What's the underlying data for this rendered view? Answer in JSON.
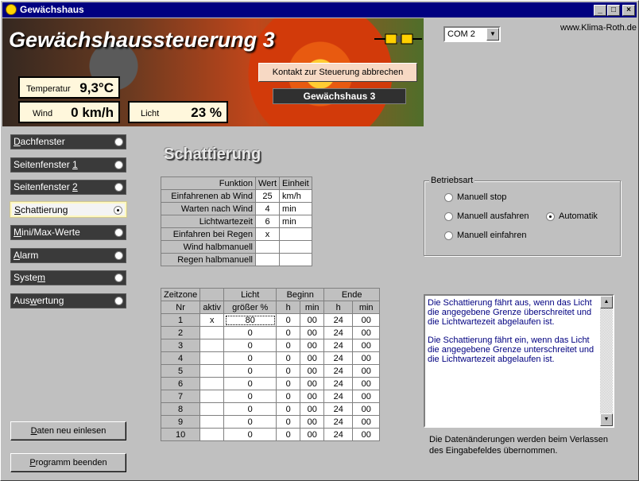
{
  "window": {
    "title": "Gewächshaus",
    "buttons": [
      "_",
      "□",
      "×"
    ]
  },
  "header": {
    "title": "Gewächshaussteuerung 3",
    "url": "www.Klima-Roth.de",
    "com_port": "COM 2",
    "temperature": {
      "label": "Temperatur",
      "value": "9,3°C"
    },
    "wind": {
      "label": "Wind",
      "value": "0 km/h"
    },
    "light": {
      "label": "Licht",
      "value": "23 %"
    },
    "abort_button": "Kontakt zur Steuerung abbrechen",
    "greenhouse_name": "Gewächshaus 3"
  },
  "nav": {
    "items": [
      {
        "pre": "",
        "ak": "D",
        "post": "achfenster",
        "active": false
      },
      {
        "pre": "Seitenfenster ",
        "ak": "1",
        "post": "",
        "active": false
      },
      {
        "pre": "Seitenfenster ",
        "ak": "2",
        "post": "",
        "active": false
      },
      {
        "pre": "",
        "ak": "S",
        "post": "chattierung",
        "active": true
      },
      {
        "pre": "",
        "ak": "M",
        "post": "ini/Max-Werte",
        "active": false
      },
      {
        "pre": "",
        "ak": "A",
        "post": "larm",
        "active": false
      },
      {
        "pre": "Syste",
        "ak": "m",
        "post": "",
        "active": false
      },
      {
        "pre": "Aus",
        "ak": "w",
        "post": "ertung",
        "active": false
      }
    ]
  },
  "buttons": {
    "reload": {
      "pre": "",
      "ak": "D",
      "post": "aten neu einlesen"
    },
    "quit": {
      "pre": "",
      "ak": "P",
      "post": "rogramm beenden"
    }
  },
  "section": {
    "title": "Schattierung"
  },
  "params_table": {
    "headers": [
      "Funktion",
      "Wert",
      "Einheit"
    ],
    "rows": [
      [
        "Einfahrenen ab Wind",
        "25",
        "km/h"
      ],
      [
        "Warten nach Wind",
        "4",
        "min"
      ],
      [
        "Lichtwartezeit",
        "6",
        "min"
      ],
      [
        "Einfahren bei Regen",
        "x",
        ""
      ],
      [
        "Wind halbmanuell",
        "",
        ""
      ],
      [
        "Regen halbmanuell",
        "",
        ""
      ]
    ]
  },
  "zones_table": {
    "header_top": [
      "Zeitzone",
      "",
      "Licht",
      "Beginn",
      "Ende"
    ],
    "header_sub": [
      "Nr",
      "aktiv",
      "größer %",
      "h",
      "min",
      "h",
      "min"
    ],
    "rows": [
      [
        "1",
        "x",
        "80",
        "0",
        "00",
        "24",
        "00"
      ],
      [
        "2",
        "",
        "0",
        "0",
        "00",
        "24",
        "00"
      ],
      [
        "3",
        "",
        "0",
        "0",
        "00",
        "24",
        "00"
      ],
      [
        "4",
        "",
        "0",
        "0",
        "00",
        "24",
        "00"
      ],
      [
        "5",
        "",
        "0",
        "0",
        "00",
        "24",
        "00"
      ],
      [
        "6",
        "",
        "0",
        "0",
        "00",
        "24",
        "00"
      ],
      [
        "7",
        "",
        "0",
        "0",
        "00",
        "24",
        "00"
      ],
      [
        "8",
        "",
        "0",
        "0",
        "00",
        "24",
        "00"
      ],
      [
        "9",
        "",
        "0",
        "0",
        "00",
        "24",
        "00"
      ],
      [
        "10",
        "",
        "0",
        "0",
        "00",
        "24",
        "00"
      ]
    ]
  },
  "betriebsart": {
    "legend": "Betriebsart",
    "options": [
      {
        "label": "Manuell stop",
        "selected": false
      },
      {
        "label": "Manuell ausfahren",
        "selected": false
      },
      {
        "label": "Manuell einfahren",
        "selected": false
      },
      {
        "label": "Automatik",
        "selected": true
      }
    ]
  },
  "info": {
    "p1": "Die Schattierung fährt aus, wenn das Licht die angegebene Grenze überschreitet und die Lichtwartezeit abgelaufen ist.",
    "p2": "Die Schattierung fährt ein, wenn das Licht die angegebene Grenze unterschreitet und die Lichtwartezeit abgelaufen ist."
  },
  "note": "Die Datenänderungen werden beim Verlassen des Eingabefeldes übernommen."
}
